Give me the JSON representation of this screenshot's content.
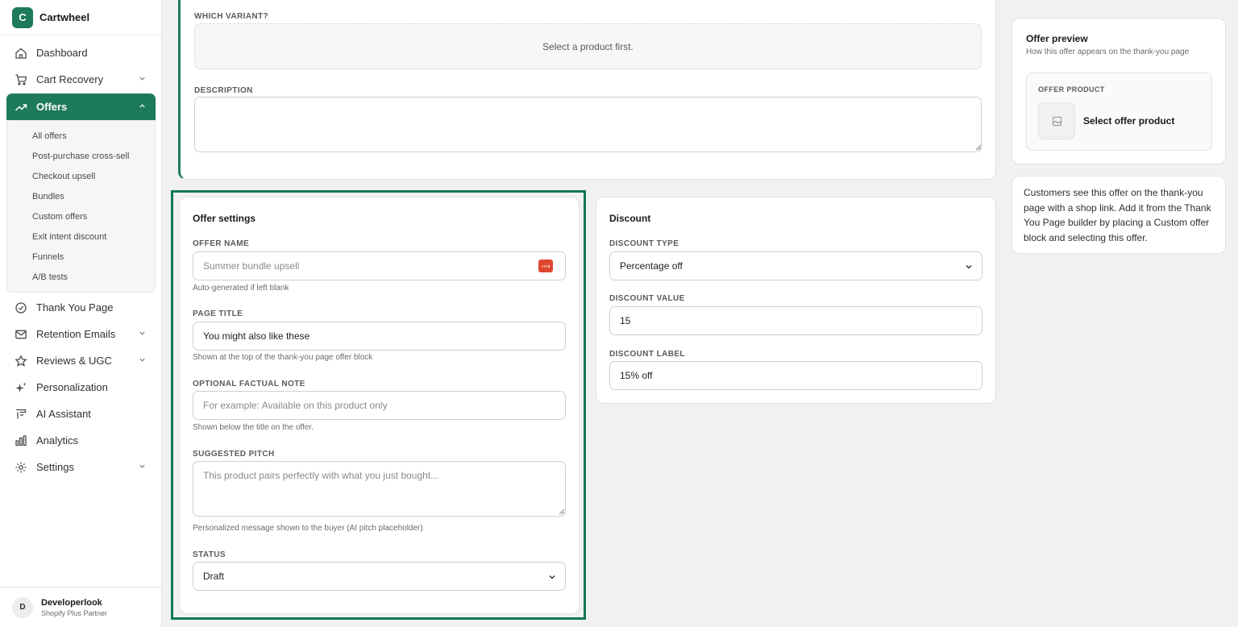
{
  "app": {
    "logo_letter": "C",
    "name": "Cartwheel"
  },
  "sidebar": {
    "items": [
      {
        "label": "Dashboard"
      },
      {
        "label": "Cart Recovery"
      },
      {
        "label": "Offers"
      },
      {
        "label": "Thank You Page"
      },
      {
        "label": "Retention Emails"
      },
      {
        "label": "Reviews & UGC"
      },
      {
        "label": "Personalization"
      },
      {
        "label": "AI Assistant"
      },
      {
        "label": "Analytics"
      },
      {
        "label": "Settings"
      }
    ],
    "offers_sub": [
      {
        "label": "All offers"
      },
      {
        "label": "Post-purchase cross-sell"
      },
      {
        "label": "Checkout upsell"
      },
      {
        "label": "Bundles"
      },
      {
        "label": "Custom offers"
      },
      {
        "label": "Exit intent discount"
      },
      {
        "label": "Funnels"
      },
      {
        "label": "A/B tests"
      }
    ],
    "user": {
      "initial": "D",
      "name": "Developerlook",
      "role": "Shopify Plus Partner"
    }
  },
  "product_card": {
    "variant_label": "WHICH VARIANT?",
    "variant_empty": "Select a product first.",
    "description_label": "DESCRIPTION",
    "description_value": ""
  },
  "offer_settings": {
    "title": "Offer settings",
    "offer_name_label": "OFFER NAME",
    "offer_name_placeholder": "Summer bundle upsell",
    "offer_name_help": "Auto-generated if left blank",
    "page_title_label": "PAGE TITLE",
    "page_title_value": "You might also like these",
    "page_title_help": "Shown at the top of the thank-you page offer block",
    "note_label": "OPTIONAL FACTUAL NOTE",
    "note_placeholder": "For example: Available on this product only",
    "note_help": "Shown below the title on the offer.",
    "pitch_label": "SUGGESTED PITCH",
    "pitch_placeholder": "This product pairs perfectly with what you just bought...",
    "pitch_help": "Personalized message shown to the buyer (AI pitch placeholder)",
    "status_label": "STATUS",
    "status_value": "Draft"
  },
  "discount": {
    "title": "Discount",
    "type_label": "DISCOUNT TYPE",
    "type_value": "Percentage off",
    "value_label": "DISCOUNT VALUE",
    "value_value": "15",
    "label_label": "DISCOUNT LABEL",
    "label_value": "15% off"
  },
  "preview": {
    "title": "Offer preview",
    "subtitle": "How this offer appears on the thank-you page",
    "product_label": "OFFER PRODUCT",
    "product_name": "Select offer product"
  },
  "info_text": "Customers see this offer on the thank-you page with a shop link. Add it from the Thank You Page builder by placing a Custom offer block and selecting this offer.",
  "colors": {
    "accent": "#1e7a5c",
    "highlight_border": "#0f7a4f",
    "password_icon": "#e0472f"
  }
}
